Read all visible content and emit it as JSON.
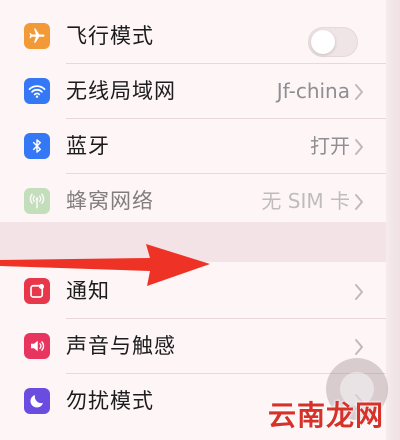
{
  "settings": {
    "group1": [
      {
        "label": "飞行模式",
        "value": "",
        "icon": "airplane-icon",
        "color": "#f19a37"
      },
      {
        "label": "无线局域网",
        "value": "Jf-china",
        "icon": "wifi-icon",
        "color": "#3478f6"
      },
      {
        "label": "蓝牙",
        "value": "打开",
        "icon": "bluetooth-icon",
        "color": "#3478f6"
      },
      {
        "label": "蜂窝网络",
        "value": "无 SIM 卡",
        "icon": "cellular-antenna-icon",
        "color": "#7cc475"
      }
    ],
    "group2": [
      {
        "label": "通知",
        "icon": "notification-icon",
        "color": "#e8374a"
      },
      {
        "label": "声音与触感",
        "icon": "speaker-icon",
        "color": "#e7355f"
      },
      {
        "label": "勿扰模式",
        "icon": "moon-icon",
        "color": "#6a4de0"
      }
    ],
    "airplane_toggle": "off"
  },
  "annotation": {
    "arrow_color": "#ee3326"
  },
  "watermark": "云南龙网"
}
